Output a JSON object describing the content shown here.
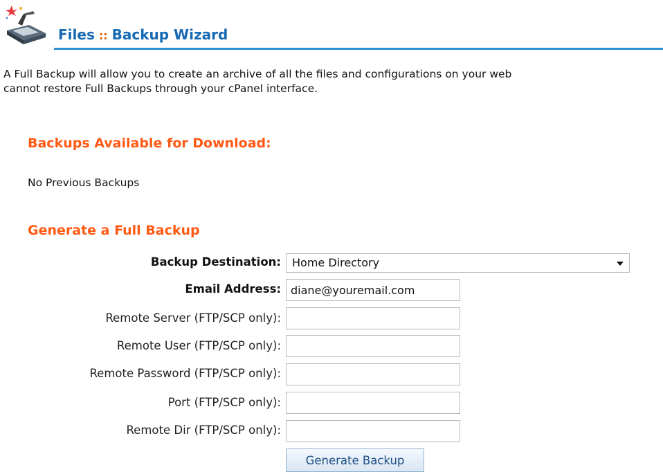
{
  "header": {
    "section": "Files",
    "separator": "::",
    "title": "Backup Wizard"
  },
  "intro": {
    "line1": "A Full Backup will allow you to create an archive of all the files and configurations on your web",
    "line2": "cannot restore Full Backups through your cPanel interface."
  },
  "backups": {
    "heading": "Backups Available for Download:",
    "empty_text": "No Previous Backups"
  },
  "generate": {
    "heading": "Generate a Full Backup",
    "destination_label": "Backup Destination:",
    "destination_value": "Home Directory",
    "email_label": "Email Address:",
    "email_value": "diane@youremail.com",
    "remote_server_label": "Remote Server (FTP/SCP only):",
    "remote_server_value": "",
    "remote_user_label": "Remote User (FTP/SCP only):",
    "remote_user_value": "",
    "remote_password_label": "Remote Password (FTP/SCP only):",
    "remote_password_value": "",
    "port_label": "Port (FTP/SCP only):",
    "port_value": "",
    "remote_dir_label": "Remote Dir (FTP/SCP only):",
    "remote_dir_value": "",
    "button_label": "Generate Backup"
  },
  "icons": {
    "header_icon": "backup-wizard-icon",
    "select_arrow": "chevron-down-icon"
  },
  "colors": {
    "title_blue": "#1669b3",
    "heading_orange": "#ff5a14",
    "rule_blue": "#2f8fd8"
  }
}
